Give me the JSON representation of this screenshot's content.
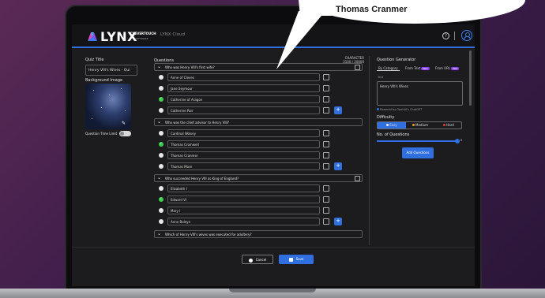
{
  "header": {
    "logo_text": "LYNX",
    "logo_sub": "CLEVERTOUCH",
    "logo_sub2": "SOFTWARE",
    "app_name": "LYNX Cloud"
  },
  "sidebar": {
    "quiz_title_label": "Quiz Title",
    "quiz_title_value": "Henry VIII's Wives - Qui",
    "background_image_label": "Background Image",
    "time_limit_label": "Question Time Limit"
  },
  "questions": {
    "label": "Questions",
    "character_label": "CHARACTER",
    "character_count": "2100 / 20000",
    "items": [
      {
        "text": "Who was Henry VIII's first wife?",
        "answers": [
          {
            "text": "Anne of Cleves",
            "correct": false
          },
          {
            "text": "Jane Seymour",
            "correct": false
          },
          {
            "text": "Catherine of Aragon",
            "correct": true
          },
          {
            "text": "Catherine Parr",
            "correct": false
          }
        ]
      },
      {
        "text": "Who was the chief advisor to Henry VIII?",
        "answers": [
          {
            "text": "Cardinal Wolsey",
            "correct": false
          },
          {
            "text": "Thomas Cromwell",
            "correct": true
          },
          {
            "text": "Thomas Cranmer",
            "correct": false
          },
          {
            "text": "Thomas More",
            "correct": false
          }
        ]
      },
      {
        "text": "Who succeeded Henry VIII as King of England?",
        "answers": [
          {
            "text": "Elizabeth I",
            "correct": false
          },
          {
            "text": "Edward VI",
            "correct": true
          },
          {
            "text": "Mary I",
            "correct": false
          },
          {
            "text": "Anne Boleyn",
            "correct": false
          }
        ]
      },
      {
        "text": "Which of Henry VIII's wives was executed for adultery?",
        "answers": []
      }
    ]
  },
  "generator": {
    "title": "Question Generator",
    "tabs": [
      "By Category",
      "From Text",
      "From URL"
    ],
    "pro_badge": "PRO",
    "text_label": "Text",
    "text_value": "Henry VIII's Wives",
    "powered_by": "Powered by OpenAI's ChatGPT",
    "difficulty_label": "Difficulty",
    "difficulty_options": [
      "Easy",
      "Medium",
      "Hard"
    ],
    "difficulty_selected": "Easy",
    "num_questions_label": "No. of Questions",
    "num_questions_value": "5",
    "num_questions_fraction": 0.98,
    "add_button": "Add Questions"
  },
  "footer": {
    "cancel": "Cancel",
    "save": "Save"
  },
  "callout": {
    "text": "Thomas Cranmer"
  },
  "colors": {
    "accent": "#2f6fe0",
    "correct": "#3ccf4e",
    "pro": "#8a3ff0"
  }
}
